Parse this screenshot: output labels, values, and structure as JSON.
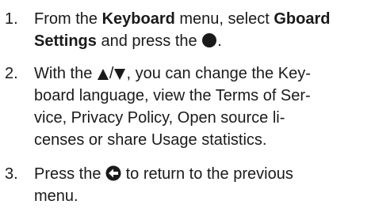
{
  "steps": [
    {
      "number": "1.",
      "t1": "From the ",
      "menu": "Keyboard",
      "t2": " menu, select ",
      "item": "Gboard Settings",
      "t3": " and press the ",
      "icon": "ok-button-icon",
      "t4": "."
    },
    {
      "number": "2.",
      "t1": "With the ",
      "icon_up": "up-arrow-icon",
      "sep": "/",
      "icon_down": "down-arrow-icon",
      "t2": ", you can change the Key-",
      "l2": "board language, view the Terms of Ser-",
      "l3": "vice, Privacy Policy, Open source li-",
      "l4": "censes or share Usage statistics."
    },
    {
      "number": "3.",
      "t1": "Press the ",
      "icon": "back-button-icon",
      "t2": " to return to the previous",
      "l2": "menu."
    }
  ],
  "colors": {
    "text": "#1a1a1a",
    "icon": "#1a1a1a"
  }
}
